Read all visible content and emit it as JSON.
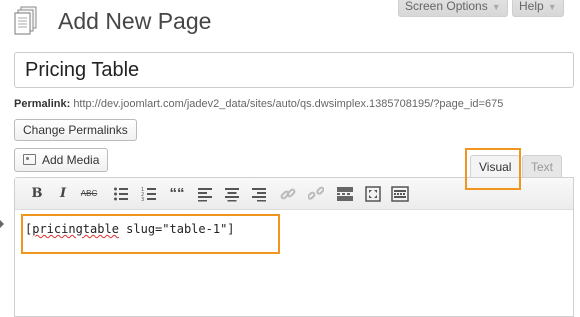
{
  "header": {
    "title": "Add New Page",
    "screen_options_label": "Screen Options",
    "help_label": "Help"
  },
  "post": {
    "title_value": "Pricing Table"
  },
  "permalink": {
    "label": "Permalink:",
    "url": "http://dev.joomlart.com/jadev2_data/sites/auto/qs.dwsimplex.1385708195/?page_id=675",
    "change_button": "Change Permalinks"
  },
  "media": {
    "add_media_label": "Add Media"
  },
  "editor": {
    "tabs": [
      "Visual",
      "Text"
    ],
    "active_tab": "Visual",
    "toolbar": {
      "bold": "B",
      "italic": "I",
      "strikethrough": "ABC",
      "blockquote": "““"
    },
    "content_word": "pricingtable",
    "content_rest": " slug=\"table-1\"]",
    "content_open": "["
  },
  "colors": {
    "highlight": "#f0961e",
    "spellcheck": "#e03030"
  }
}
